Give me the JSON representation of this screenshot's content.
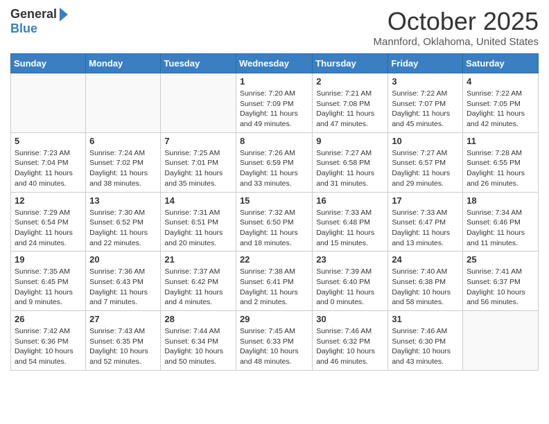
{
  "logo": {
    "general": "General",
    "blue": "Blue"
  },
  "title": {
    "month": "October 2025",
    "location": "Mannford, Oklahoma, United States"
  },
  "weekdays": [
    "Sunday",
    "Monday",
    "Tuesday",
    "Wednesday",
    "Thursday",
    "Friday",
    "Saturday"
  ],
  "weeks": [
    [
      {
        "day": "",
        "info": ""
      },
      {
        "day": "",
        "info": ""
      },
      {
        "day": "",
        "info": ""
      },
      {
        "day": "1",
        "info": "Sunrise: 7:20 AM\nSunset: 7:09 PM\nDaylight: 11 hours and 49 minutes."
      },
      {
        "day": "2",
        "info": "Sunrise: 7:21 AM\nSunset: 7:08 PM\nDaylight: 11 hours and 47 minutes."
      },
      {
        "day": "3",
        "info": "Sunrise: 7:22 AM\nSunset: 7:07 PM\nDaylight: 11 hours and 45 minutes."
      },
      {
        "day": "4",
        "info": "Sunrise: 7:22 AM\nSunset: 7:05 PM\nDaylight: 11 hours and 42 minutes."
      }
    ],
    [
      {
        "day": "5",
        "info": "Sunrise: 7:23 AM\nSunset: 7:04 PM\nDaylight: 11 hours and 40 minutes."
      },
      {
        "day": "6",
        "info": "Sunrise: 7:24 AM\nSunset: 7:02 PM\nDaylight: 11 hours and 38 minutes."
      },
      {
        "day": "7",
        "info": "Sunrise: 7:25 AM\nSunset: 7:01 PM\nDaylight: 11 hours and 35 minutes."
      },
      {
        "day": "8",
        "info": "Sunrise: 7:26 AM\nSunset: 6:59 PM\nDaylight: 11 hours and 33 minutes."
      },
      {
        "day": "9",
        "info": "Sunrise: 7:27 AM\nSunset: 6:58 PM\nDaylight: 11 hours and 31 minutes."
      },
      {
        "day": "10",
        "info": "Sunrise: 7:27 AM\nSunset: 6:57 PM\nDaylight: 11 hours and 29 minutes."
      },
      {
        "day": "11",
        "info": "Sunrise: 7:28 AM\nSunset: 6:55 PM\nDaylight: 11 hours and 26 minutes."
      }
    ],
    [
      {
        "day": "12",
        "info": "Sunrise: 7:29 AM\nSunset: 6:54 PM\nDaylight: 11 hours and 24 minutes."
      },
      {
        "day": "13",
        "info": "Sunrise: 7:30 AM\nSunset: 6:52 PM\nDaylight: 11 hours and 22 minutes."
      },
      {
        "day": "14",
        "info": "Sunrise: 7:31 AM\nSunset: 6:51 PM\nDaylight: 11 hours and 20 minutes."
      },
      {
        "day": "15",
        "info": "Sunrise: 7:32 AM\nSunset: 6:50 PM\nDaylight: 11 hours and 18 minutes."
      },
      {
        "day": "16",
        "info": "Sunrise: 7:33 AM\nSunset: 6:48 PM\nDaylight: 11 hours and 15 minutes."
      },
      {
        "day": "17",
        "info": "Sunrise: 7:33 AM\nSunset: 6:47 PM\nDaylight: 11 hours and 13 minutes."
      },
      {
        "day": "18",
        "info": "Sunrise: 7:34 AM\nSunset: 6:46 PM\nDaylight: 11 hours and 11 minutes."
      }
    ],
    [
      {
        "day": "19",
        "info": "Sunrise: 7:35 AM\nSunset: 6:45 PM\nDaylight: 11 hours and 9 minutes."
      },
      {
        "day": "20",
        "info": "Sunrise: 7:36 AM\nSunset: 6:43 PM\nDaylight: 11 hours and 7 minutes."
      },
      {
        "day": "21",
        "info": "Sunrise: 7:37 AM\nSunset: 6:42 PM\nDaylight: 11 hours and 4 minutes."
      },
      {
        "day": "22",
        "info": "Sunrise: 7:38 AM\nSunset: 6:41 PM\nDaylight: 11 hours and 2 minutes."
      },
      {
        "day": "23",
        "info": "Sunrise: 7:39 AM\nSunset: 6:40 PM\nDaylight: 11 hours and 0 minutes."
      },
      {
        "day": "24",
        "info": "Sunrise: 7:40 AM\nSunset: 6:38 PM\nDaylight: 10 hours and 58 minutes."
      },
      {
        "day": "25",
        "info": "Sunrise: 7:41 AM\nSunset: 6:37 PM\nDaylight: 10 hours and 56 minutes."
      }
    ],
    [
      {
        "day": "26",
        "info": "Sunrise: 7:42 AM\nSunset: 6:36 PM\nDaylight: 10 hours and 54 minutes."
      },
      {
        "day": "27",
        "info": "Sunrise: 7:43 AM\nSunset: 6:35 PM\nDaylight: 10 hours and 52 minutes."
      },
      {
        "day": "28",
        "info": "Sunrise: 7:44 AM\nSunset: 6:34 PM\nDaylight: 10 hours and 50 minutes."
      },
      {
        "day": "29",
        "info": "Sunrise: 7:45 AM\nSunset: 6:33 PM\nDaylight: 10 hours and 48 minutes."
      },
      {
        "day": "30",
        "info": "Sunrise: 7:46 AM\nSunset: 6:32 PM\nDaylight: 10 hours and 46 minutes."
      },
      {
        "day": "31",
        "info": "Sunrise: 7:46 AM\nSunset: 6:30 PM\nDaylight: 10 hours and 43 minutes."
      },
      {
        "day": "",
        "info": ""
      }
    ]
  ]
}
